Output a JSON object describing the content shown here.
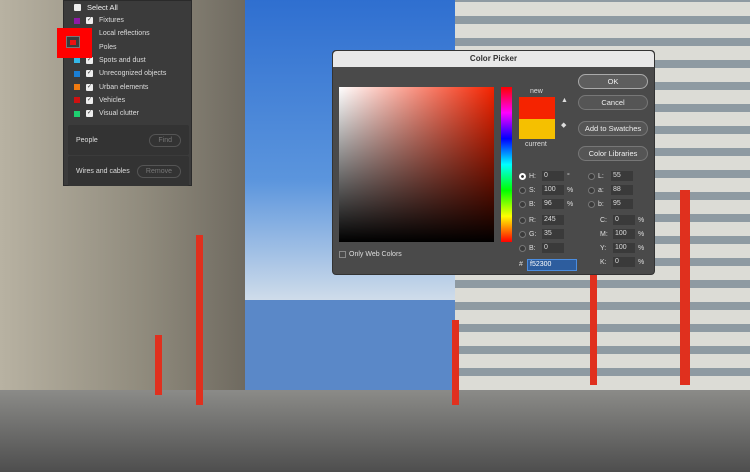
{
  "layers_panel": {
    "select_all": "Select All",
    "items": [
      {
        "label": "Fixtures",
        "color": "#8e1aa6",
        "checked": true
      },
      {
        "label": "Local reflections",
        "color": "",
        "checked": false
      },
      {
        "label": "Poles",
        "color": "#e01010",
        "checked": false
      },
      {
        "label": "Spots and dust",
        "color": "#34b8e8",
        "checked": true
      },
      {
        "label": "Unrecognized objects",
        "color": "#1a7fd6",
        "checked": true
      },
      {
        "label": "Urban elements",
        "color": "#f07a10",
        "checked": true
      },
      {
        "label": "Vehicles",
        "color": "#d01010",
        "checked": true
      },
      {
        "label": "Visual clutter",
        "color": "#1ed070",
        "checked": true
      }
    ],
    "people": {
      "label": "People",
      "button": "Find"
    },
    "wires": {
      "label": "Wires and cables",
      "button": "Remove"
    }
  },
  "color_picker": {
    "title": "Color Picker",
    "new_label": "new",
    "current_label": "current",
    "only_web": "Only Web Colors",
    "buttons": {
      "ok": "OK",
      "cancel": "Cancel",
      "add": "Add to Swatches",
      "libraries": "Color Libraries"
    },
    "hsb": [
      {
        "k": "H:",
        "v": "0",
        "u": "°"
      },
      {
        "k": "S:",
        "v": "100",
        "u": "%"
      },
      {
        "k": "B:",
        "v": "96",
        "u": "%"
      }
    ],
    "rgb": [
      {
        "k": "R:",
        "v": "245"
      },
      {
        "k": "G:",
        "v": "35"
      },
      {
        "k": "B:",
        "v": "0"
      }
    ],
    "lab": [
      {
        "k": "L:",
        "v": "55"
      },
      {
        "k": "a:",
        "v": "88"
      },
      {
        "k": "b:",
        "v": "95"
      }
    ],
    "cmyk": [
      {
        "k": "C:",
        "v": "0",
        "u": "%"
      },
      {
        "k": "M:",
        "v": "100",
        "u": "%"
      },
      {
        "k": "Y:",
        "v": "100",
        "u": "%"
      },
      {
        "k": "K:",
        "v": "0",
        "u": "%"
      }
    ],
    "hex_label": "#",
    "hex": "f52300",
    "new_color": "#f52300",
    "current_color": "#f5c000"
  }
}
